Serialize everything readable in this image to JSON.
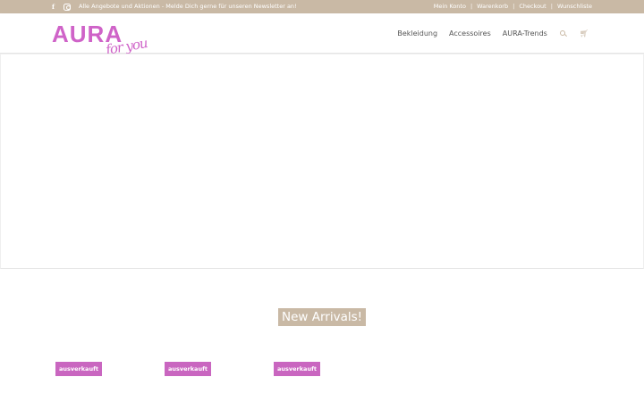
{
  "topbar": {
    "promo": "Alle Angebote und Aktionen - Melde Dich gerne für unseren Newsletter an!",
    "social": [
      {
        "icon": "facebook-icon"
      },
      {
        "icon": "instagram-icon"
      }
    ],
    "links": [
      "Mein Konto",
      "Warenkorb",
      "Checkout",
      "Wunschliste"
    ],
    "separator": "|"
  },
  "logo": {
    "main": "AURA",
    "script": "for you",
    "color": "#cf63c8"
  },
  "nav": {
    "items": [
      "Bekleidung",
      "Accessoires",
      "AURA-Trends"
    ],
    "search_icon": "search-icon",
    "cart_icon": "cart-icon"
  },
  "section": {
    "title": "New Arrivals!"
  },
  "products": [
    {
      "badge": "ausverkauft"
    },
    {
      "badge": "ausverkauft"
    },
    {
      "badge": "ausverkauft"
    }
  ],
  "colors": {
    "accent": "#c9b9a5",
    "brand": "#cf63c8",
    "badge": "#c966c0"
  }
}
